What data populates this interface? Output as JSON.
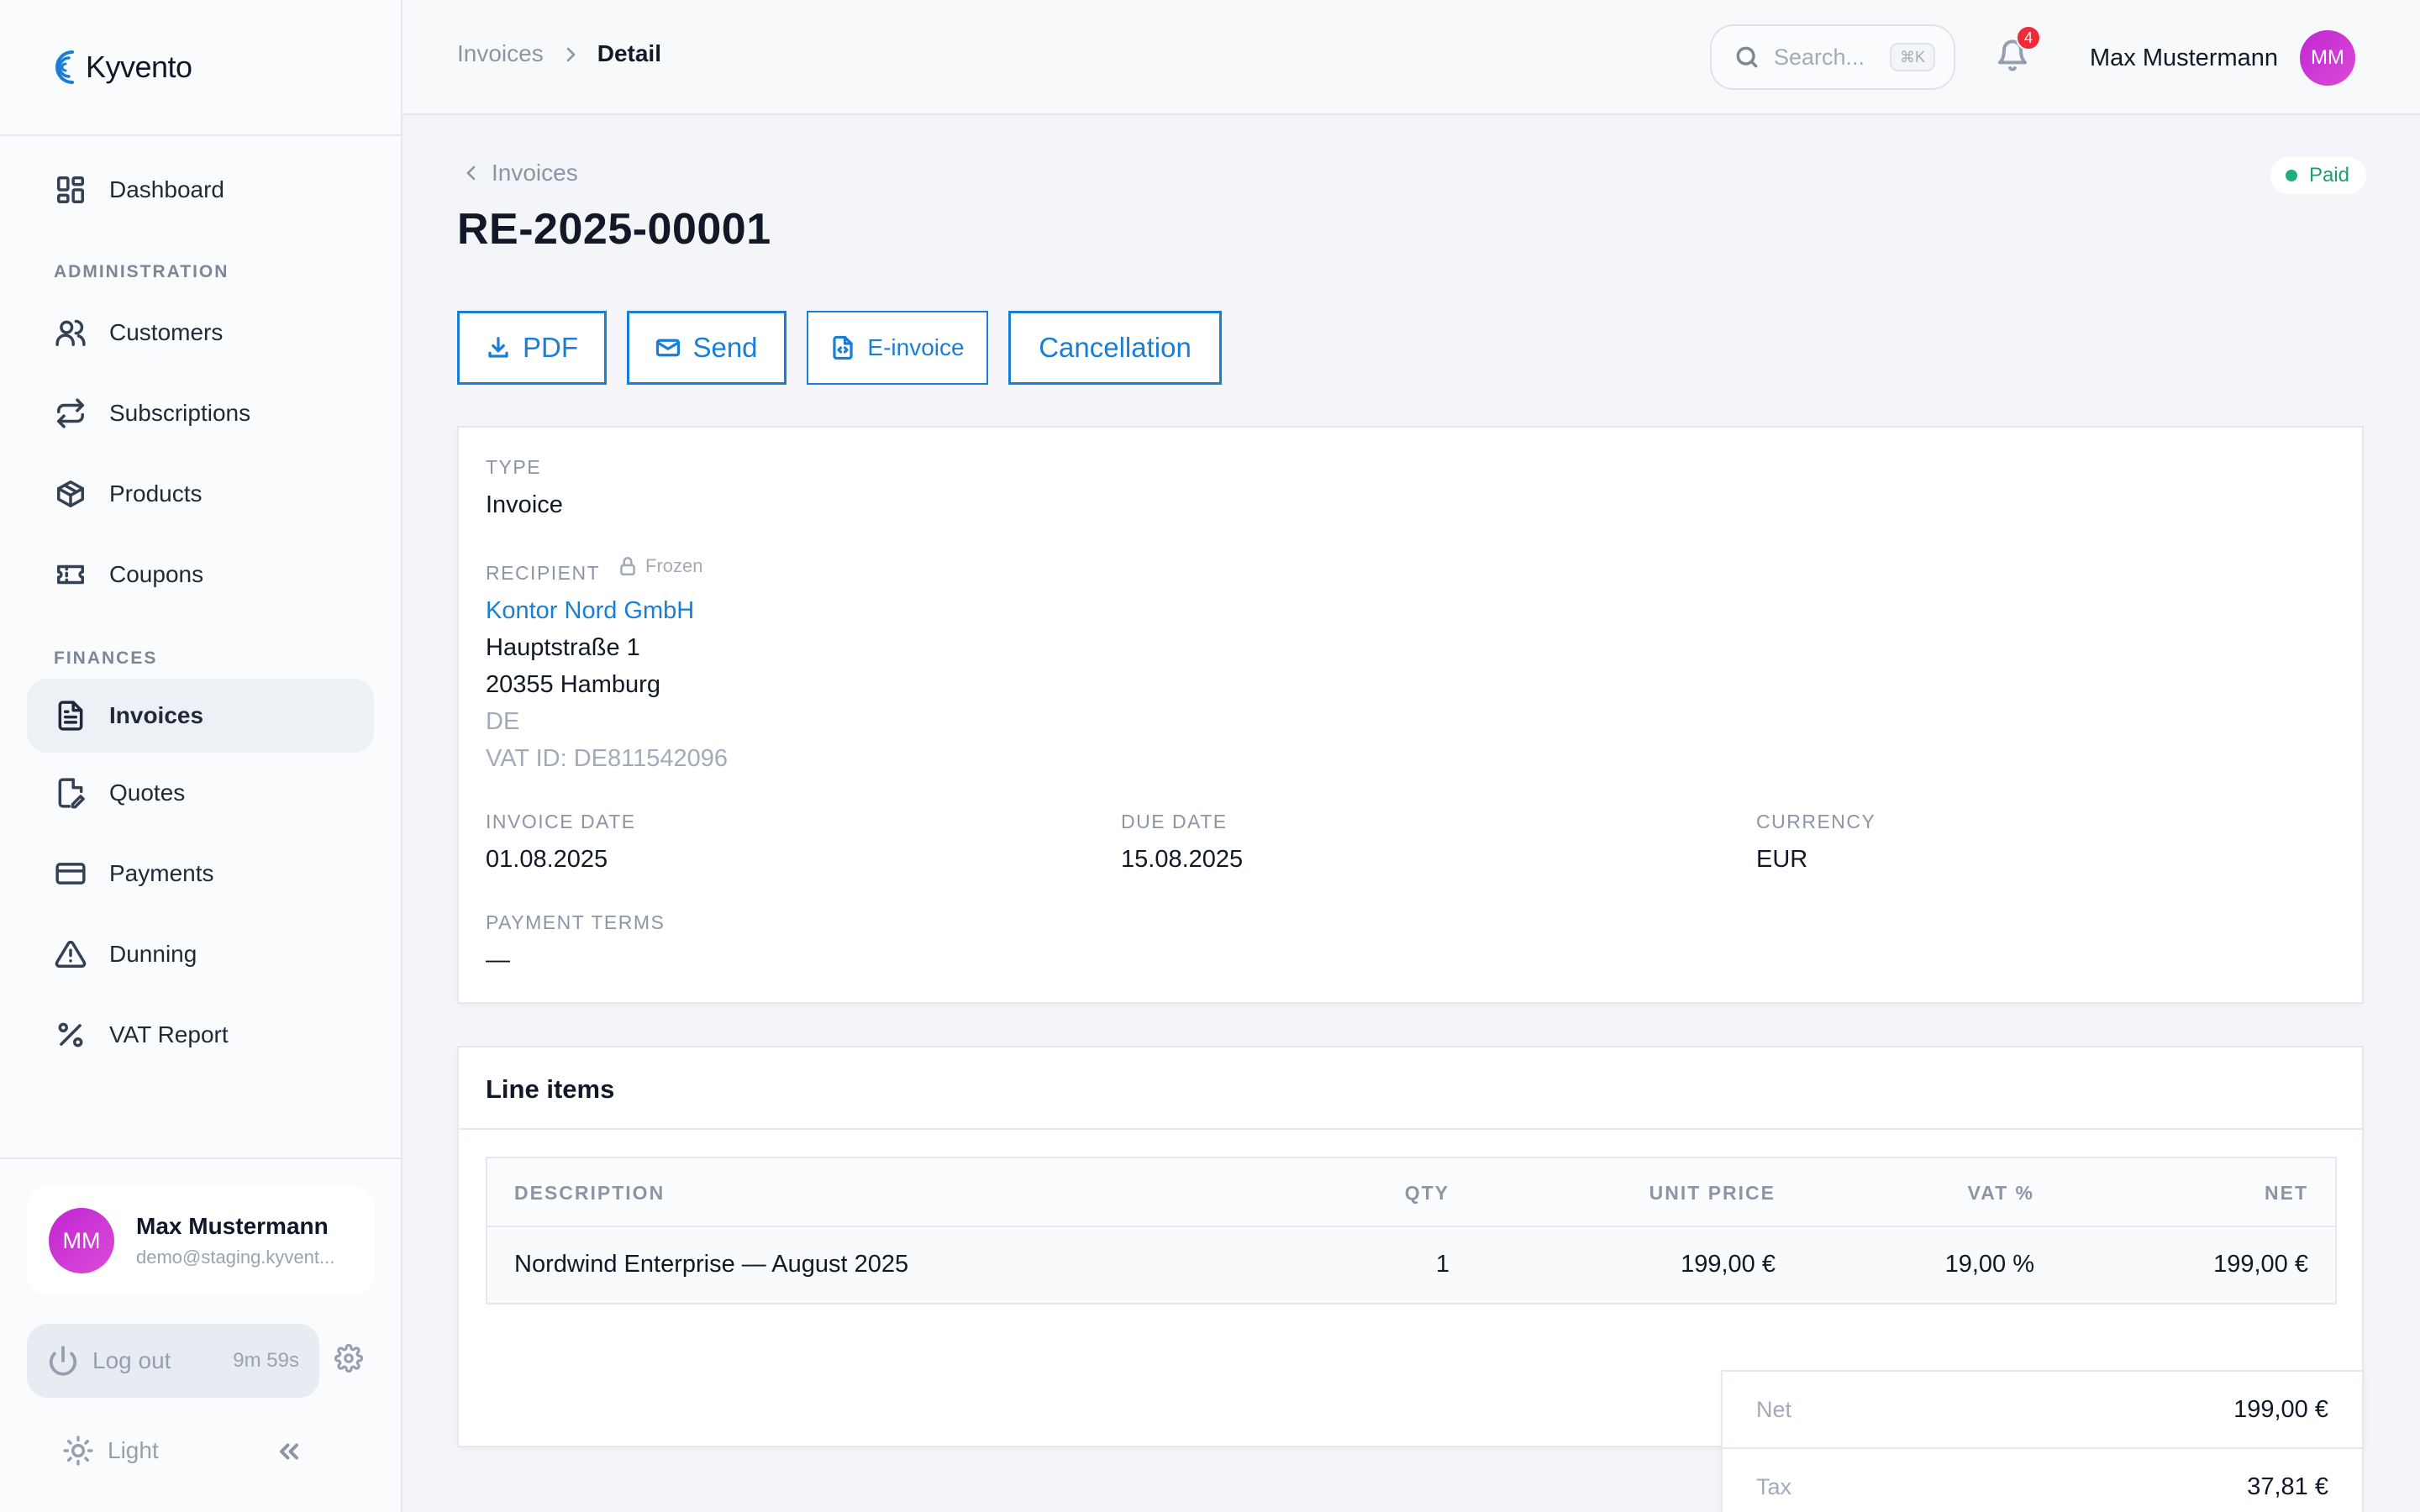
{
  "brand": {
    "name": "Kyvento"
  },
  "sidebar": {
    "items": [
      {
        "label": "Dashboard",
        "icon": "dashboard-icon"
      },
      {
        "label": "Customers",
        "icon": "users-icon"
      },
      {
        "label": "Subscriptions",
        "icon": "repeat-icon"
      },
      {
        "label": "Products",
        "icon": "box-icon"
      },
      {
        "label": "Coupons",
        "icon": "ticket-icon"
      },
      {
        "label": "Invoices",
        "icon": "file-text-icon",
        "active": true
      },
      {
        "label": "Quotes",
        "icon": "file-edit-icon"
      },
      {
        "label": "Payments",
        "icon": "credit-card-icon"
      },
      {
        "label": "Dunning",
        "icon": "alert-triangle-icon"
      },
      {
        "label": "VAT Report",
        "icon": "percent-icon"
      }
    ],
    "sections": {
      "administration": "ADMINISTRATION",
      "finances": "FINANCES"
    },
    "user": {
      "initials": "MM",
      "name": "Max Mustermann",
      "email": "demo@staging.kyvent..."
    },
    "logout": {
      "label": "Log out",
      "timer": "9m 59s"
    },
    "theme": {
      "label": "Light"
    }
  },
  "topbar": {
    "breadcrumb": {
      "parent": "Invoices",
      "current": "Detail"
    },
    "search": {
      "placeholder": "Search...",
      "shortcut": "⌘K"
    },
    "notifications": {
      "count": "4"
    },
    "user": {
      "name": "Max Mustermann",
      "initials": "MM"
    }
  },
  "invoice": {
    "back_label": "Invoices",
    "status": "Paid",
    "number": "RE-2025-00001",
    "actions": {
      "pdf": "PDF",
      "send": "Send",
      "einvoice": "E-invoice",
      "cancellation": "Cancellation"
    },
    "type_label": "TYPE",
    "type_value": "Invoice",
    "recipient_label": "RECIPIENT",
    "frozen_label": "Frozen",
    "recipient": {
      "name": "Kontor Nord GmbH",
      "street": "Hauptstraße 1",
      "city": "20355 Hamburg",
      "country": "DE",
      "vat_id": "VAT ID: DE811542096"
    },
    "invoice_date_label": "INVOICE DATE",
    "invoice_date": "01.08.2025",
    "due_date_label": "DUE DATE",
    "due_date": "15.08.2025",
    "currency_label": "CURRENCY",
    "currency": "EUR",
    "payment_terms_label": "PAYMENT TERMS",
    "payment_terms": "—"
  },
  "line_items": {
    "title": "Line items",
    "columns": {
      "description": "DESCRIPTION",
      "qty": "QTY",
      "unit_price": "UNIT PRICE",
      "vat": "VAT %",
      "net": "NET"
    },
    "rows": [
      {
        "description": "Nordwind Enterprise — August 2025",
        "qty": "1",
        "unit_price": "199,00 €",
        "vat": "19,00 %",
        "net": "199,00 €"
      }
    ]
  },
  "totals": {
    "net_label": "Net",
    "net_value": "199,00 €",
    "tax_label": "Tax",
    "tax_value": "37,81 €"
  },
  "colors": {
    "accent": "#1a7fd4",
    "status_paid": "#1fb07a",
    "avatar": "#c026d3",
    "badge": "#ef2b3a"
  }
}
